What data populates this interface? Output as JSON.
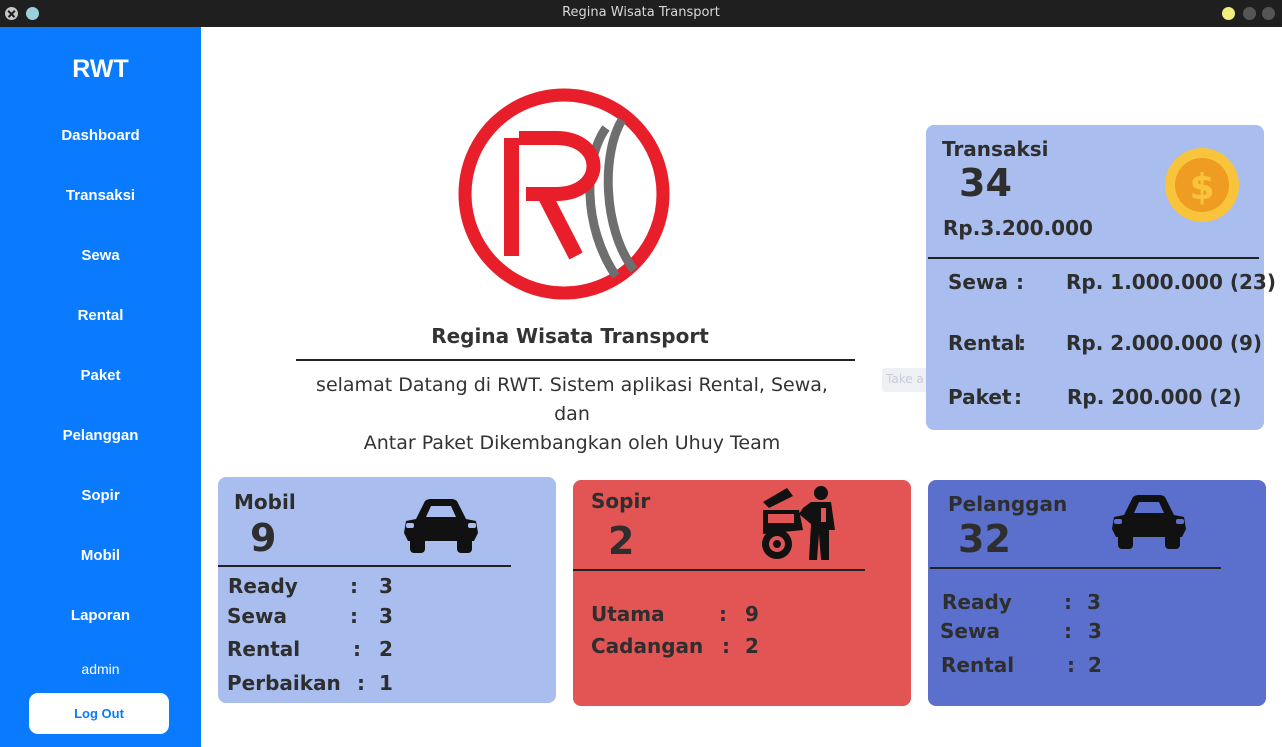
{
  "window": {
    "title": "Regina Wisata Transport"
  },
  "sidebar": {
    "brand": "RWT",
    "items": [
      {
        "label": "Dashboard"
      },
      {
        "label": "Transaksi"
      },
      {
        "label": "Sewa"
      },
      {
        "label": "Rental"
      },
      {
        "label": "Paket"
      },
      {
        "label": "Pelanggan"
      },
      {
        "label": "Sopir"
      },
      {
        "label": "Mobil"
      },
      {
        "label": "Laporan"
      }
    ],
    "user": "admin",
    "logout_label": "Log Out",
    "color": "#0a7bff"
  },
  "hero": {
    "logo_icon": "rwt-logo-icon",
    "company_name": "Regina Wisata Transport",
    "tagline_line1": "selamat Datang di RWT. Sistem aplikasi Rental, Sewa, dan",
    "tagline_line2": "Antar Paket Dikembangkan oleh Uhuy Team",
    "logo_colors": {
      "ring": "#e81e2a",
      "stripes": "#6e6e6e"
    }
  },
  "ghost_tooltip": "Take a New Screenshot",
  "transaksi": {
    "title": "Transaksi",
    "count": "34",
    "total": "Rp.3.200.000",
    "icon": "coin-dollar-icon",
    "color": "#a9bdef",
    "rows": [
      {
        "label": "Sewa",
        "colon": ":",
        "value": "Rp. 1.000.000 (23)"
      },
      {
        "label": "Rental",
        "colon": ":",
        "value": "Rp. 2.000.000 (9)"
      },
      {
        "label": "Paket",
        "colon": ":",
        "value": "Rp. 200.000 (2)"
      }
    ]
  },
  "mobil": {
    "title": "Mobil",
    "count": "9",
    "icon": "car-icon",
    "color": "#a9bdef",
    "rows": [
      {
        "label": "Ready",
        "colon": ":",
        "value": "3"
      },
      {
        "label": "Sewa",
        "colon": ":",
        "value": "3"
      },
      {
        "label": "Rental",
        "colon": ":",
        "value": "2"
      },
      {
        "label": "Perbaikan",
        "colon": ":",
        "value": "1"
      }
    ]
  },
  "sopir": {
    "title": "Sopir",
    "count": "2",
    "icon": "mechanic-icon",
    "color": "#e35454",
    "rows": [
      {
        "label": "Utama",
        "colon": ":",
        "value": "9"
      },
      {
        "label": "Cadangan",
        "colon": ":",
        "value": "2"
      }
    ]
  },
  "pelanggan": {
    "title": "Pelanggan",
    "count": "32",
    "icon": "car-icon",
    "color": "#5a70cc",
    "rows": [
      {
        "label": "Ready",
        "colon": ":",
        "value": "3"
      },
      {
        "label": "Sewa",
        "colon": ":",
        "value": "3"
      },
      {
        "label": "Rental",
        "colon": ":",
        "value": "2"
      }
    ]
  }
}
